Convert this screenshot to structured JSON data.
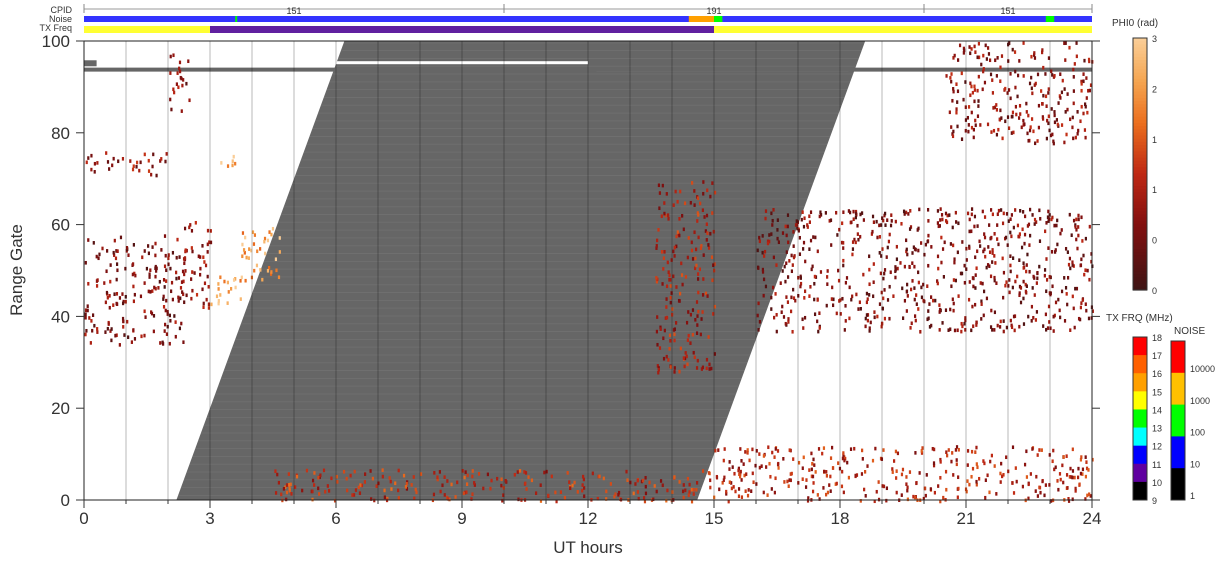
{
  "chart_data": {
    "type": "heatmap",
    "xlabel": "UT hours",
    "ylabel": "Range Gate",
    "xlim": [
      0,
      24
    ],
    "ylim": [
      0,
      100
    ],
    "x_ticks": [
      "0",
      "3",
      "6",
      "9",
      "12",
      "15",
      "18",
      "21",
      "24"
    ],
    "y_ticks": [
      "0",
      "20",
      "40",
      "60",
      "80",
      "100"
    ],
    "header_rows": [
      "CPID",
      "Noise",
      "TX Freq"
    ],
    "cpid_segments": [
      {
        "label": "151",
        "start": 0,
        "end": 10
      },
      {
        "label": "191",
        "start": 10,
        "end": 20
      },
      {
        "label": "151",
        "start": 20,
        "end": 24
      }
    ],
    "tx_freq_segments": [
      {
        "start": 0,
        "end": 3,
        "freq_mhz": 14.5
      },
      {
        "start": 3,
        "end": 15,
        "freq_mhz": 10.5
      },
      {
        "start": 15,
        "end": 24,
        "freq_mhz": 14.5
      }
    ],
    "ground_scatter_band": {
      "description": "grey parallelogram",
      "bottom_start_hr": 2.2,
      "bottom_end_hr": 14.6,
      "top_start_hr": 6.2,
      "top_end_hr": 18.6,
      "top_gate": 100
    },
    "scatter_regions": [
      {
        "x": [
          0.0,
          2.4
        ],
        "y": [
          34,
          58
        ],
        "phi0": 0.8
      },
      {
        "x": [
          2.3,
          3.0
        ],
        "y": [
          42,
          61
        ],
        "phi0": 0.9
      },
      {
        "x": [
          3.0,
          3.8
        ],
        "y": [
          43,
          50
        ],
        "phi0": 2.6
      },
      {
        "x": [
          3.7,
          4.7
        ],
        "y": [
          48,
          60
        ],
        "phi0": 2.5
      },
      {
        "x": [
          0.0,
          2.0
        ],
        "y": [
          71,
          76
        ],
        "phi0": 1.0
      },
      {
        "x": [
          2.0,
          2.5
        ],
        "y": [
          85,
          98
        ],
        "phi0": 0.9
      },
      {
        "x": [
          3.2,
          3.6
        ],
        "y": [
          72,
          77
        ],
        "phi0": 2.7
      },
      {
        "x": [
          16.0,
          24.0
        ],
        "y": [
          37,
          64
        ],
        "phi0": 0.8
      },
      {
        "x": [
          20.5,
          24.0
        ],
        "y": [
          78,
          100
        ],
        "phi0": 0.9
      },
      {
        "x": [
          13.6,
          15.0
        ],
        "y": [
          28,
          70
        ],
        "phi0": 1.2
      },
      {
        "x": [
          4.5,
          15.0
        ],
        "y": [
          0,
          7
        ],
        "phi0": 1.4
      },
      {
        "x": [
          15.0,
          24.0
        ],
        "y": [
          0,
          12
        ],
        "phi0": 1.3
      }
    ],
    "colorbars": {
      "phi0": {
        "title": "PHI0 (rad)",
        "labels": [
          "3",
          "2",
          "1",
          "1",
          "0",
          "0"
        ],
        "range": [
          0,
          3
        ]
      },
      "tx_frq": {
        "title": "TX FRQ (MHz)",
        "labels": [
          "18",
          "17",
          "16",
          "15",
          "14",
          "13",
          "12",
          "11",
          "10",
          "9"
        ],
        "colors": [
          "#ff0000",
          "#ff6000",
          "#ffa000",
          "#ffff00",
          "#00ff00",
          "#00ffff",
          "#0000ff",
          "#6000a0",
          "#000000"
        ]
      },
      "noise": {
        "title": "NOISE",
        "labels": [
          "10000",
          "1000",
          "100",
          "10",
          "1"
        ],
        "colors": [
          "#ff0000",
          "#ffc000",
          "#00ff00",
          "#0000ff",
          "#000000"
        ]
      }
    },
    "colors": {
      "ground_scatter": "#666666",
      "noise_bar": "#3333ff",
      "tx_low": "#6020a0",
      "tx_high": "#ffff33"
    }
  }
}
